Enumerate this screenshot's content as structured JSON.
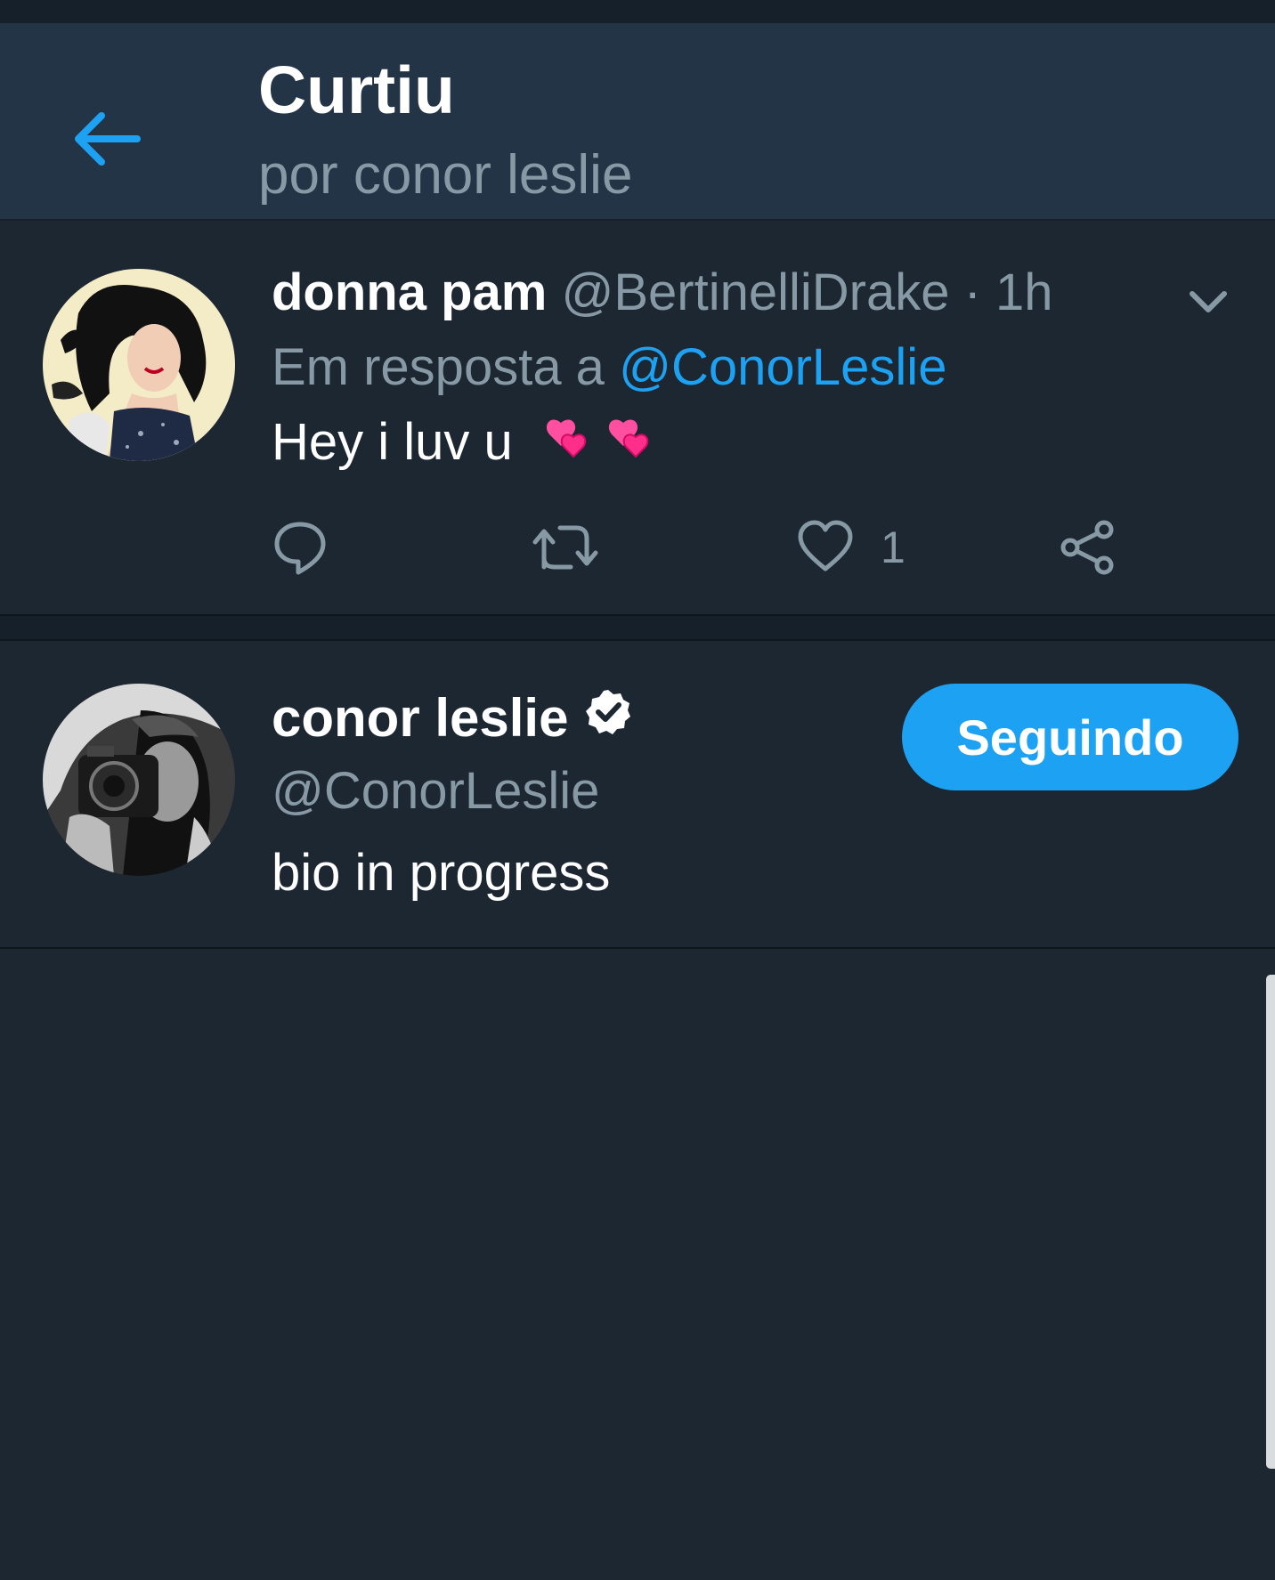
{
  "header": {
    "title": "Curtiu",
    "subtitle": "por conor leslie"
  },
  "tweet": {
    "display_name": "donna pam",
    "handle": "@BertinelliDrake",
    "separator": " · ",
    "time": "1h",
    "reply_prefix": "Em resposta a ",
    "reply_to": "@ConorLeslie",
    "text": "Hey i luv u",
    "emoji": "💞💞",
    "like_count": "1"
  },
  "user": {
    "display_name": "conor leslie",
    "handle": "@ConorLeslie",
    "bio": "bio in progress",
    "follow_label": "Seguindo"
  },
  "colors": {
    "accent": "#1da1f2",
    "background": "#1c2732",
    "header": "#243447",
    "muted": "#8899a6"
  }
}
